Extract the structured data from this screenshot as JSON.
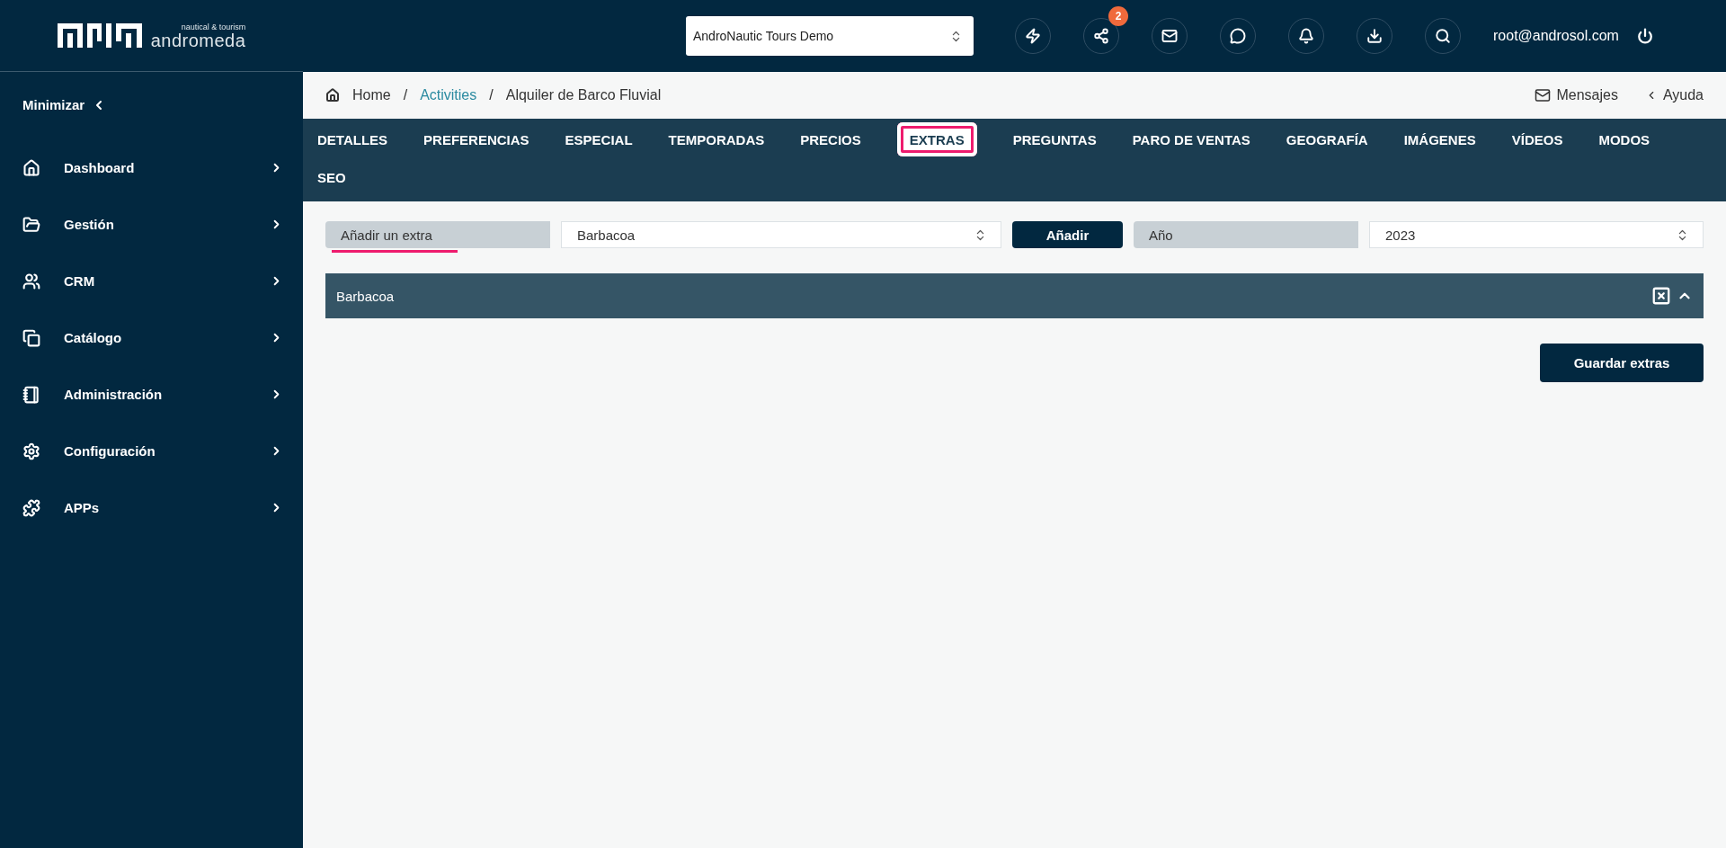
{
  "logo": {
    "tagline": "nautical & tourism",
    "name": "andromeda"
  },
  "sidebar": {
    "minimize": "Minimizar",
    "items": [
      {
        "label": "Dashboard"
      },
      {
        "label": "Gestión"
      },
      {
        "label": "CRM"
      },
      {
        "label": "Catálogo"
      },
      {
        "label": "Administración"
      },
      {
        "label": "Configuración"
      },
      {
        "label": "APPs"
      }
    ]
  },
  "header": {
    "company_select": "AndroNautic Tours Demo",
    "notifications_badge": "2",
    "user": "root@androsol.com"
  },
  "breadcrumb": [
    {
      "label": "Home",
      "kind": "home"
    },
    {
      "separator": "/",
      "label": "Activities",
      "kind": "link"
    },
    {
      "separator": "/",
      "label": "Alquiler de Barco Fluvial",
      "kind": "current"
    }
  ],
  "top_links": [
    {
      "label": "Mensajes"
    },
    {
      "label": "Ayuda"
    }
  ],
  "tabs": [
    {
      "label": "DETALLES",
      "selected": false
    },
    {
      "label": "PREFERENCIAS",
      "selected": false
    },
    {
      "label": "ESPECIAL",
      "selected": false
    },
    {
      "label": "TEMPORADAS",
      "selected": false
    },
    {
      "label": "PRECIOS",
      "selected": false
    },
    {
      "label": "EXTRAS",
      "selected": true
    },
    {
      "label": "PREGUNTAS",
      "selected": false
    },
    {
      "label": "PARO DE VENTAS",
      "selected": false
    },
    {
      "label": "GEOGRAFÍA",
      "selected": false
    },
    {
      "label": "IMÁGENES",
      "selected": false
    },
    {
      "label": "VÍDEOS",
      "selected": false
    },
    {
      "label": "MODOS",
      "selected": false
    },
    {
      "label": "SEO",
      "selected": false
    }
  ],
  "form": {
    "extra_label": "Añadir un extra",
    "extra_label_underlined": true,
    "extra_select": "Barbacoa",
    "add_button": "Añadir",
    "year_label": "Año",
    "year_select": "2023"
  },
  "extras": [
    {
      "title": "Barbacoa",
      "expanded": true
    }
  ],
  "save_button": "Guardar extras"
}
